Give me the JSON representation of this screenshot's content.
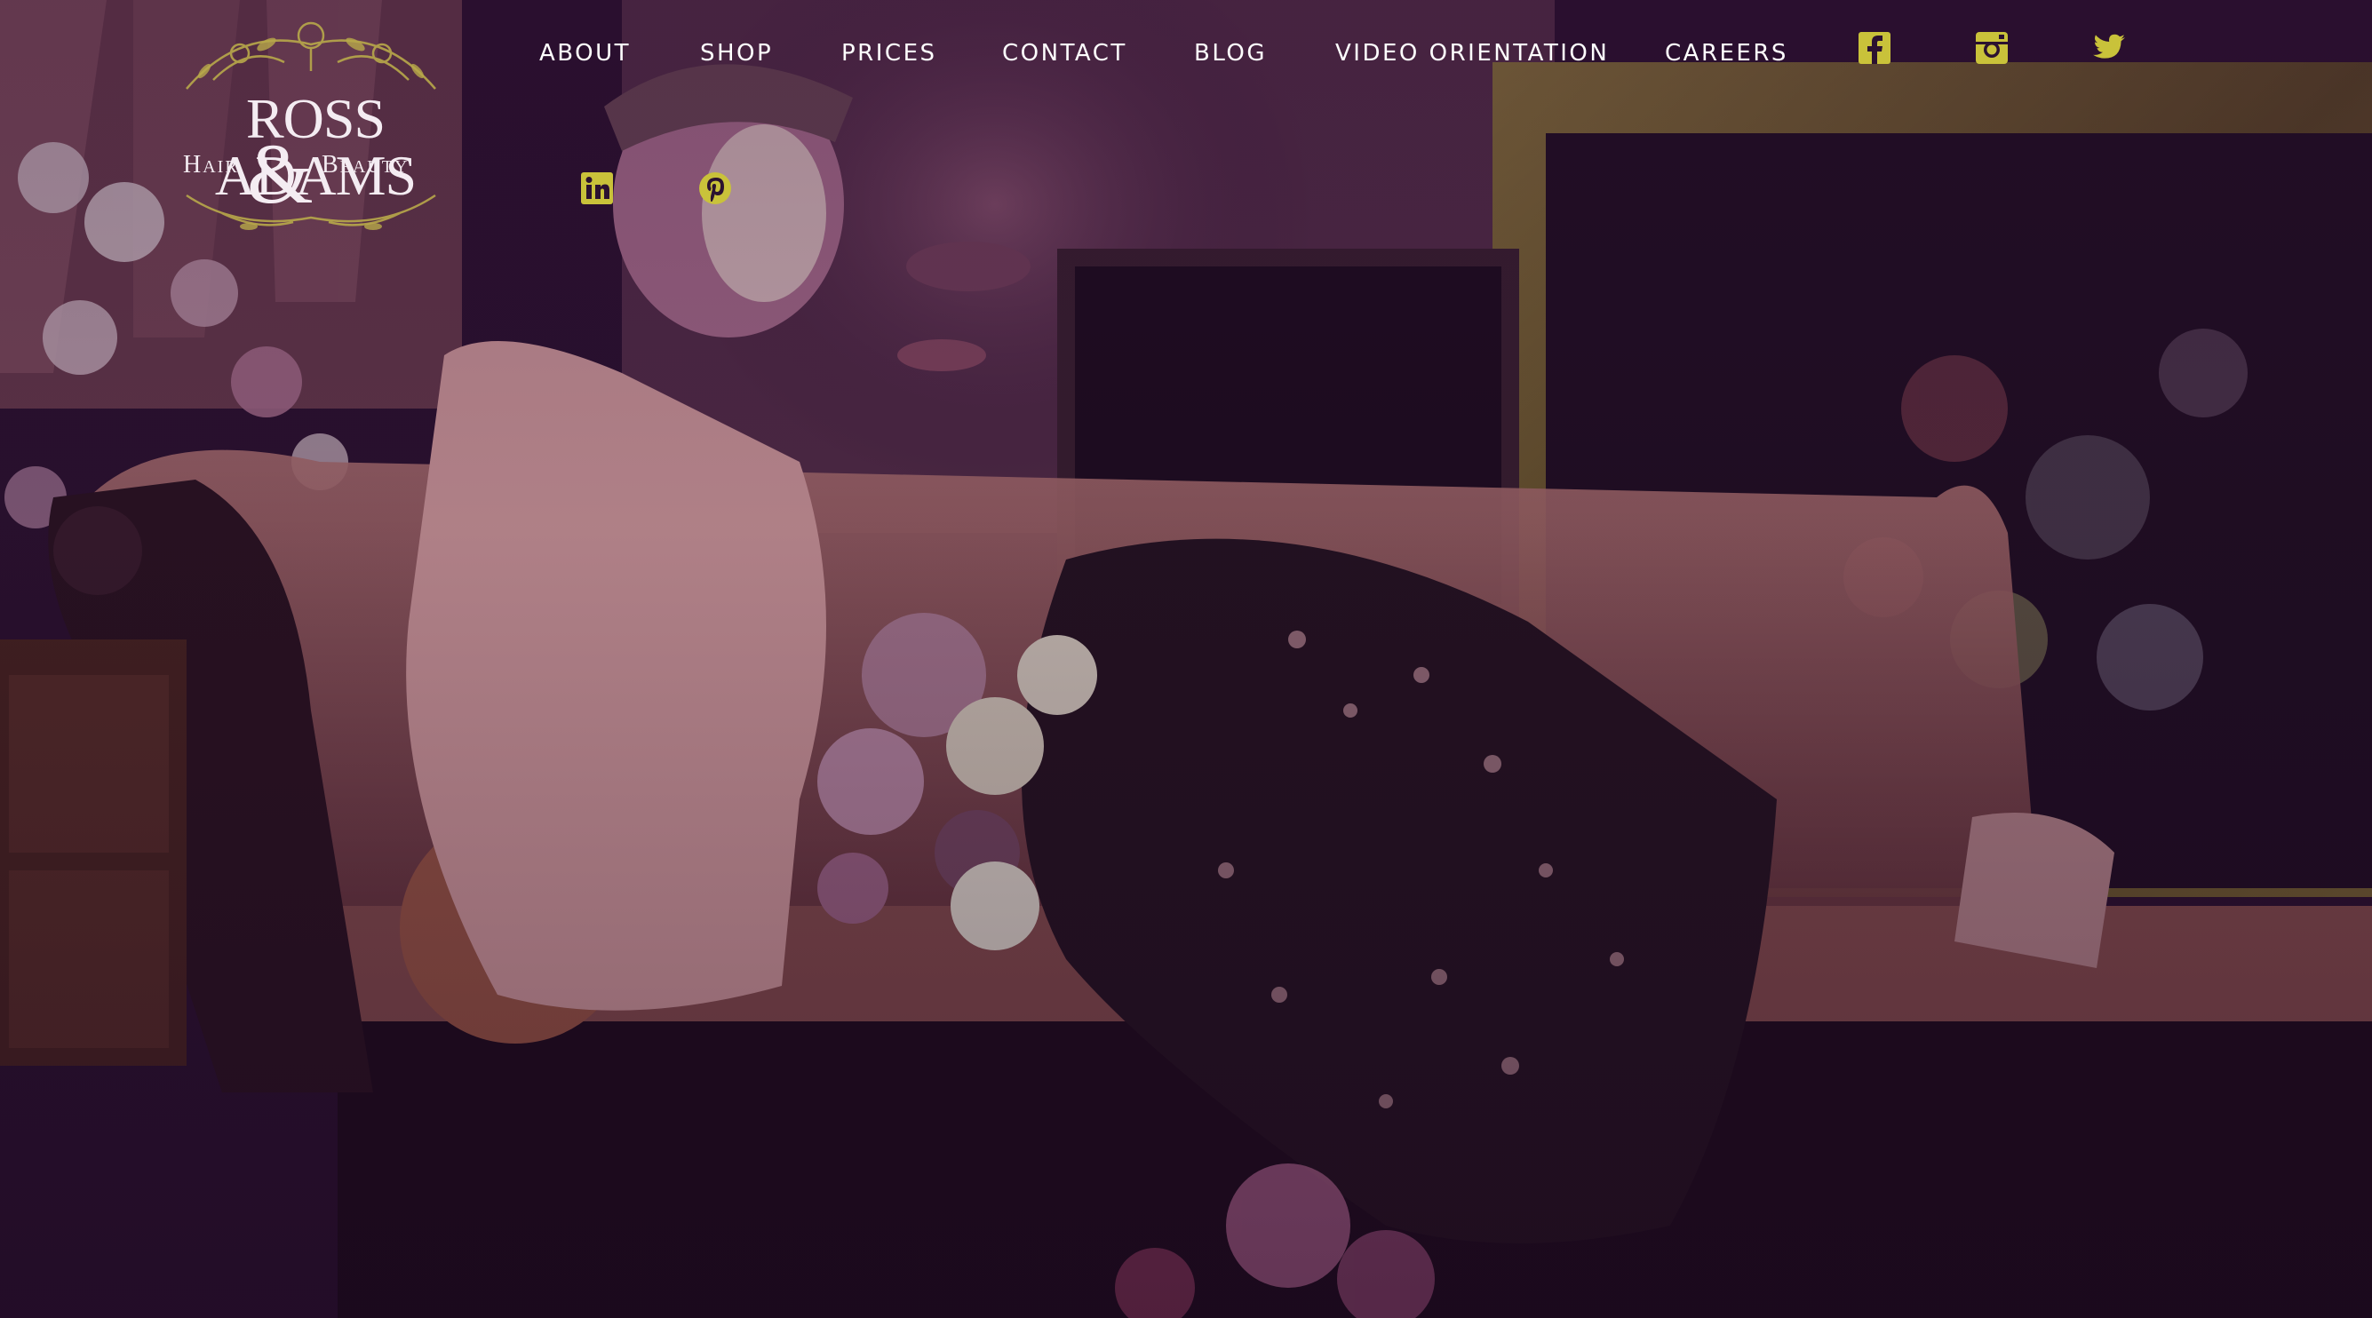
{
  "brand": {
    "name": "ROSS ADAMS",
    "sub_left": "Hair",
    "ampersand": "&",
    "sub_right": "Beauty"
  },
  "nav": {
    "items": [
      {
        "label": "ABOUT"
      },
      {
        "label": "SHOP"
      },
      {
        "label": "PRICES"
      },
      {
        "label": "CONTACT"
      },
      {
        "label": "BLOG"
      },
      {
        "label": "VIDEO ORIENTATION"
      },
      {
        "label": "CAREERS"
      }
    ]
  },
  "social": [
    {
      "icon": "facebook-icon"
    },
    {
      "icon": "instagram-icon"
    },
    {
      "icon": "twitter-icon"
    },
    {
      "icon": "linkedin-icon"
    },
    {
      "icon": "pinterest-icon"
    }
  ],
  "colors": {
    "icon_accent": "#c9c23a",
    "nav_text": "#ffffff",
    "overlay": "#2a0f2e"
  }
}
